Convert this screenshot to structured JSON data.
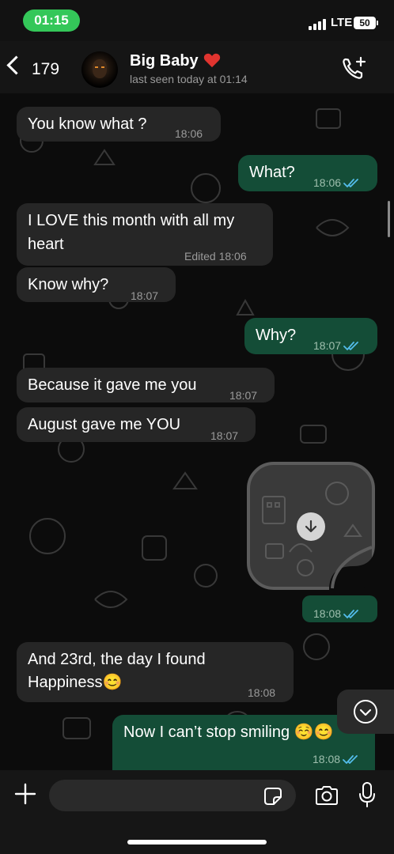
{
  "status_bar": {
    "time": "01:15",
    "network": "LTE",
    "battery": "50"
  },
  "header": {
    "back_count": "179",
    "contact_name": "Big Baby",
    "last_seen": "last seen today at 01:14"
  },
  "messages": [
    {
      "dir": "in",
      "text": "You know what ?",
      "time": "18:06"
    },
    {
      "dir": "out",
      "text": "What?",
      "time": "18:06",
      "read": true
    },
    {
      "dir": "in",
      "text_lines": [
        "I LOVE this month with all my",
        "heart"
      ],
      "edited": "Edited",
      "time": "18:06"
    },
    {
      "dir": "in",
      "text": "Know why?",
      "time": "18:07"
    },
    {
      "dir": "out",
      "text": "Why?",
      "time": "18:07",
      "read": true
    },
    {
      "dir": "in",
      "text": "Because it gave me you",
      "time": "18:07"
    },
    {
      "dir": "in",
      "text": "August gave me YOU",
      "time": "18:07"
    },
    {
      "dir": "out",
      "type": "sticker",
      "time": "18:08",
      "read": true
    },
    {
      "dir": "in",
      "text_lines": [
        "And 23rd, the day I found",
        "Happiness😊"
      ],
      "time": "18:08"
    },
    {
      "dir": "out",
      "text": "Now I can’t stop smiling ☺️😊",
      "time": "18:08",
      "read": true
    }
  ],
  "input": {
    "value": "",
    "placeholder": ""
  },
  "colors": {
    "status_pill": "#34c759",
    "incoming_bubble": "#262626",
    "outgoing_bubble": "#144d37",
    "read_ticks": "#53bdeb",
    "heart": "#e0342f"
  },
  "icons": [
    "back-chevron-icon",
    "call-add-icon",
    "download-icon",
    "chevron-down-icon",
    "plus-icon",
    "sticker-icon",
    "camera-icon",
    "mic-icon"
  ]
}
